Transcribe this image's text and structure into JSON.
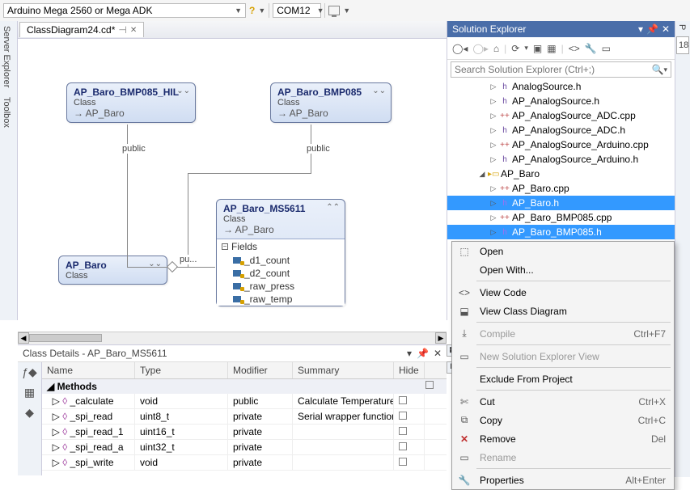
{
  "toolbar": {
    "board": "Arduino Mega 2560 or Mega ADK",
    "port": "COM12"
  },
  "side_tabs": [
    "Server Explorer",
    "Toolbox"
  ],
  "doc_tab": "ClassDiagram24.cd*",
  "classes": {
    "bmp085_hil": {
      "name": "AP_Baro_BMP085_HIL",
      "kind": "Class",
      "inherits": "AP_Baro"
    },
    "bmp085": {
      "name": "AP_Baro_BMP085",
      "kind": "Class",
      "inherits": "AP_Baro"
    },
    "ms5611": {
      "name": "AP_Baro_MS5611",
      "kind": "Class",
      "inherits": "AP_Baro"
    },
    "baro": {
      "name": "AP_Baro",
      "kind": "Class"
    }
  },
  "ms5611_fields_title": "Fields",
  "ms5611_fields": [
    "_d1_count",
    "_d2_count",
    "_raw_press",
    "_raw_temp"
  ],
  "conn_labels": {
    "public1": "public",
    "public2": "public",
    "pu": "pu..."
  },
  "solution": {
    "title": "Solution Explorer",
    "search_placeholder": "Search Solution Explorer (Ctrl+;)",
    "tree": [
      {
        "depth": 3,
        "arrow": "▷",
        "icon": "h",
        "label": "AnalogSource.h"
      },
      {
        "depth": 3,
        "arrow": "▷",
        "icon": "h",
        "label": "AP_AnalogSource.h"
      },
      {
        "depth": 3,
        "arrow": "▷",
        "icon": "cpp",
        "label": "AP_AnalogSource_ADC.cpp"
      },
      {
        "depth": 3,
        "arrow": "▷",
        "icon": "h",
        "label": "AP_AnalogSource_ADC.h"
      },
      {
        "depth": 3,
        "arrow": "▷",
        "icon": "cpp",
        "label": "AP_AnalogSource_Arduino.cpp"
      },
      {
        "depth": 3,
        "arrow": "▷",
        "icon": "h",
        "label": "AP_AnalogSource_Arduino.h"
      },
      {
        "depth": 2,
        "arrow": "◢",
        "icon": "folder",
        "label": "AP_Baro"
      },
      {
        "depth": 3,
        "arrow": "▷",
        "icon": "cpp",
        "label": "AP_Baro.cpp"
      },
      {
        "depth": 3,
        "arrow": "▷",
        "icon": "h",
        "label": "AP_Baro.h",
        "sel": true
      },
      {
        "depth": 3,
        "arrow": "▷",
        "icon": "cpp",
        "label": "AP_Baro_BMP085.cpp"
      },
      {
        "depth": 3,
        "arrow": "▷",
        "icon": "h",
        "label": "AP_Baro_BMP085.h",
        "sel": true
      }
    ]
  },
  "context_menu": [
    {
      "icon": "⬚",
      "text": "Open"
    },
    {
      "text": "Open With..."
    },
    {
      "sep": true
    },
    {
      "icon": "<>",
      "text": "View Code"
    },
    {
      "icon": "⬓",
      "text": "View Class Diagram"
    },
    {
      "sep": true
    },
    {
      "icon": "⤓",
      "text": "Compile",
      "short": "Ctrl+F7",
      "disabled": true
    },
    {
      "sep": true
    },
    {
      "icon": "▭",
      "text": "New Solution Explorer View",
      "disabled": true
    },
    {
      "sep": true
    },
    {
      "text": "Exclude From Project"
    },
    {
      "sep": true
    },
    {
      "icon": "✄",
      "text": "Cut",
      "short": "Ctrl+X"
    },
    {
      "icon": "⧉",
      "text": "Copy",
      "short": "Ctrl+C"
    },
    {
      "icon": "✕",
      "text": "Remove",
      "short": "Del",
      "del": true
    },
    {
      "icon": "▭",
      "text": "Rename",
      "disabled": true
    },
    {
      "sep": true
    },
    {
      "icon": "🔧",
      "text": "Properties",
      "short": "Alt+Enter"
    }
  ],
  "details": {
    "title": "Class Details - AP_Baro_MS5611",
    "cols": {
      "name": "Name",
      "type": "Type",
      "modifier": "Modifier",
      "summary": "Summary",
      "hide": "Hide"
    },
    "section": "Methods",
    "rows": [
      {
        "name": "_calculate",
        "type": "void",
        "mod": "public",
        "sum": "Calculate Temperature"
      },
      {
        "name": "_spi_read",
        "type": "uint8_t",
        "mod": "private",
        "sum": "Serial wrapper function"
      },
      {
        "name": "_spi_read_1",
        "type": "uint16_t",
        "mod": "private",
        "sum": ""
      },
      {
        "name": "_spi_read_a",
        "type": "uint32_t",
        "mod": "private",
        "sum": ""
      },
      {
        "name": "_spi_write",
        "type": "void",
        "mod": "private",
        "sum": ""
      }
    ]
  },
  "right_badge": "18"
}
